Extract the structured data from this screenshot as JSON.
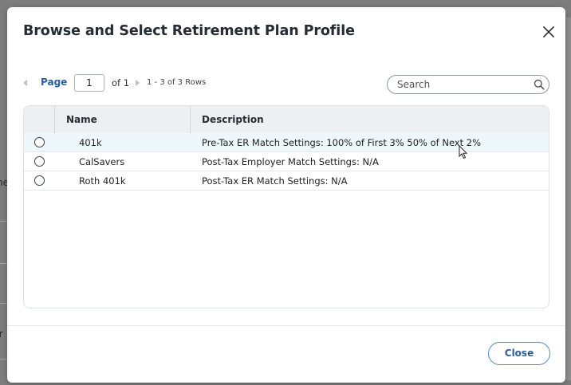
{
  "background": {
    "fragment_1": "ne",
    "fragment_2": "rr"
  },
  "dialog": {
    "title": "Browse and Select Retirement Plan Profile",
    "close_icon": "close-icon"
  },
  "pager": {
    "page_label": "Page",
    "page_value": "1",
    "of_label": "of 1",
    "rows_label": "1 - 3 of 3 Rows"
  },
  "search": {
    "placeholder": "Search",
    "icon": "search-icon"
  },
  "grid": {
    "columns": [
      "Name",
      "Description"
    ],
    "rows": [
      {
        "name": "401k",
        "description": "Pre-Tax ER Match Settings: 100% of First 3% 50% of Next 2%",
        "selected": false
      },
      {
        "name": "CalSavers",
        "description": "Post-Tax Employer Match Settings: N/A",
        "selected": false
      },
      {
        "name": "Roth 401k",
        "description": "Post-Tax ER Match Settings: N/A",
        "selected": false
      }
    ]
  },
  "footer": {
    "close_label": "Close"
  },
  "colors": {
    "accent": "#2b5f9e",
    "header_bg": "#edf0f3",
    "hover_row": "#eef7fb",
    "overlay": "#7d7d7d"
  }
}
